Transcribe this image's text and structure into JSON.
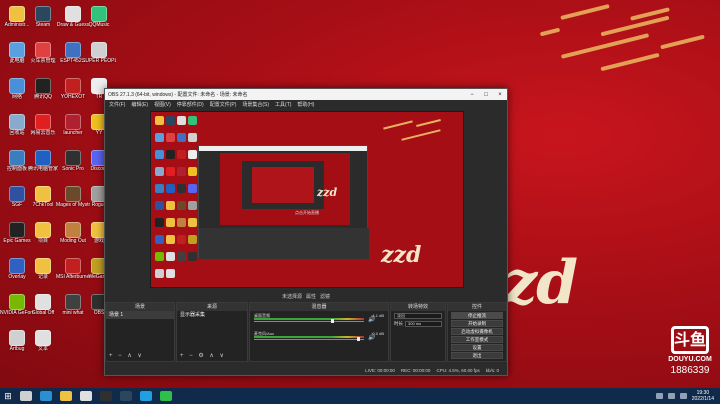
{
  "desktop": {
    "icons": [
      {
        "label": "Administr...",
        "color": "#f0c040"
      },
      {
        "label": "Steam",
        "color": "#2a475e"
      },
      {
        "label": "Draw & Guess",
        "color": "#e0e0e0"
      },
      {
        "label": "QQMusic",
        "color": "#31c27c"
      },
      {
        "label": "此电脑",
        "color": "#5aa0e0"
      },
      {
        "label": "火车票管理",
        "color": "#e04040"
      },
      {
        "label": "ESPT452...",
        "color": "#4070c0"
      },
      {
        "label": "SUPER PEOPLE",
        "color": "#d0d0d0"
      },
      {
        "label": "网络",
        "color": "#4a90d9"
      },
      {
        "label": "腾讯QQ",
        "color": "#222222"
      },
      {
        "label": "YOHEXOT",
        "color": "#c02020"
      },
      {
        "label": "TR",
        "color": "#eeeeee"
      },
      {
        "label": "回收站",
        "color": "#88aacc"
      },
      {
        "label": "网易云音乐",
        "color": "#e02020"
      },
      {
        "label": "launcher",
        "color": "#b02030"
      },
      {
        "label": "YY",
        "color": "#f0c020"
      },
      {
        "label": "控制面板",
        "color": "#3a7ec0"
      },
      {
        "label": "腾讯电脑管家",
        "color": "#2060c0"
      },
      {
        "label": "Sonic Pro",
        "color": "#303030"
      },
      {
        "label": "Discord",
        "color": "#5865f2"
      },
      {
        "label": "SGF",
        "color": "#3050a0"
      },
      {
        "label": "7ChkTool",
        "color": "#f0c040"
      },
      {
        "label": "Mages of Mystralia",
        "color": "#6a4a2a"
      },
      {
        "label": "Rogue",
        "color": "#a0a0a0"
      },
      {
        "label": "Epic Games",
        "color": "#222222"
      },
      {
        "label": "项目",
        "color": "#f0c040"
      },
      {
        "label": "Moding Out",
        "color": "#c08040"
      },
      {
        "label": "游戏",
        "color": "#f0c040"
      },
      {
        "label": "Overlay",
        "color": "#3060c0"
      },
      {
        "label": "记录",
        "color": "#f0c040"
      },
      {
        "label": "MSI Afterburner",
        "color": "#c02020"
      },
      {
        "label": "WeGame",
        "color": "#c0a020"
      },
      {
        "label": "NVIDIA GeForce",
        "color": "#76b900"
      },
      {
        "label": "Global Off",
        "color": "#e0e0e0"
      },
      {
        "label": "mini what",
        "color": "#404040"
      },
      {
        "label": "OBS",
        "color": "#303030"
      },
      {
        "label": "Artbug",
        "color": "#d0d0d0"
      },
      {
        "label": "文本",
        "color": "#e0e0e0"
      }
    ],
    "background_brand": "zzd",
    "douyu": {
      "logo": "斗鱼",
      "site": "DOUYU.COM",
      "room": "1886339"
    }
  },
  "obs": {
    "title": "OBS 27.1.3 (64-bit, windows) - 配置文件: 未命名 - 场景: 未命名",
    "window_buttons": [
      "−",
      "□",
      "×"
    ],
    "menu": [
      "文件(F)",
      "编辑(E)",
      "视图(V)",
      "停靠部件(D)",
      "配置文件(P)",
      "场景集合(S)",
      "工具(T)",
      "帮助(H)"
    ],
    "preview_brand": "zzd",
    "nested_label": "点击开始直播",
    "nested_brand": "zzd",
    "preview_bar_label": "未选择源",
    "preview_bar_buttons": [
      "属性",
      "滤镜"
    ],
    "docks": {
      "scenes": {
        "header": "场景",
        "items": [
          "场景 1"
        ],
        "foot": "+ − ∧ ∨"
      },
      "sources": {
        "header": "来源",
        "items": [
          "显示器采集"
        ],
        "foot": "+ − ⚙ ∧ ∨"
      },
      "mixer": {
        "header": "混音器",
        "tracks": [
          {
            "label": "桌面音频",
            "db": "-4.1 dB",
            "level": 0.72
          },
          {
            "label": "麦克风/Aux",
            "db": "0.0 dB",
            "level": 0.96
          }
        ]
      },
      "transitions": {
        "header": "转场特效",
        "mode": "淡出",
        "duration_label": "时长",
        "duration": "300 ms"
      },
      "controls": {
        "header": "控件",
        "buttons": [
          "停止推流",
          "开始录制",
          "启动虚拟摄像机",
          "工作室模式",
          "设置",
          "退出"
        ],
        "active": 0
      }
    },
    "status": {
      "live": "LIVE: 00:00:00",
      "rec": "REC: 00:00:00",
      "cpu": "CPU: 4.5%, 60.00 fps",
      "kbps": "kb/s: 0"
    }
  },
  "taskbar": {
    "start_label": "⊞",
    "apps": [
      {
        "name": "search",
        "color": "#d0d0d0"
      },
      {
        "name": "edge",
        "color": "#2a90d0"
      },
      {
        "name": "explorer",
        "color": "#f0c040"
      },
      {
        "name": "chrome",
        "color": "#e0e0e0"
      },
      {
        "name": "obs",
        "color": "#303030"
      },
      {
        "name": "steam",
        "color": "#2a475e"
      },
      {
        "name": "qq",
        "color": "#20a0e0"
      },
      {
        "name": "wechat",
        "color": "#2ec04a"
      }
    ],
    "clock_time": "19:30",
    "clock_date": "2022/1/14"
  }
}
